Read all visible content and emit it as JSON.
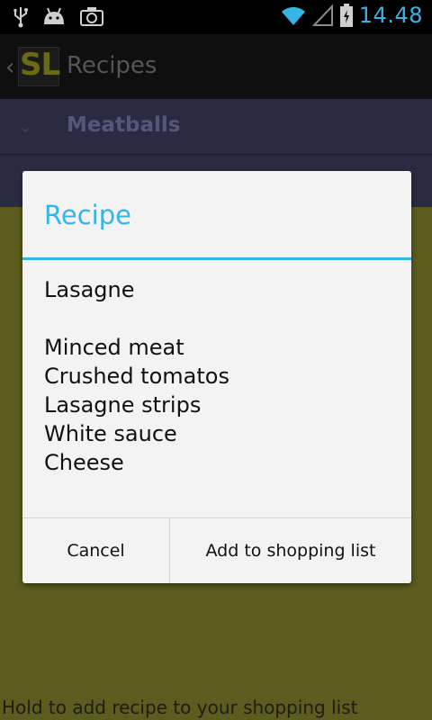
{
  "status_bar": {
    "time": "14.48",
    "icons": [
      "usb-icon",
      "android-debug-icon",
      "camera-icon",
      "wifi-icon",
      "signal-icon",
      "battery-charging-icon"
    ],
    "accent_color": "#33b5e5"
  },
  "action_bar": {
    "logo_text": "SL",
    "title": "Recipes"
  },
  "list": {
    "rows": [
      {
        "label": "Meatballs"
      }
    ]
  },
  "footer_hint": "Hold to add recipe to your shopping list",
  "dialog": {
    "title": "Recipe",
    "recipe_name": "Lasagne",
    "ingredients": [
      "Minced meat",
      "Crushed tomatos",
      "Lasagne strips",
      "White sauce",
      "Cheese"
    ],
    "buttons": {
      "cancel": "Cancel",
      "add": "Add to shopping list"
    }
  }
}
